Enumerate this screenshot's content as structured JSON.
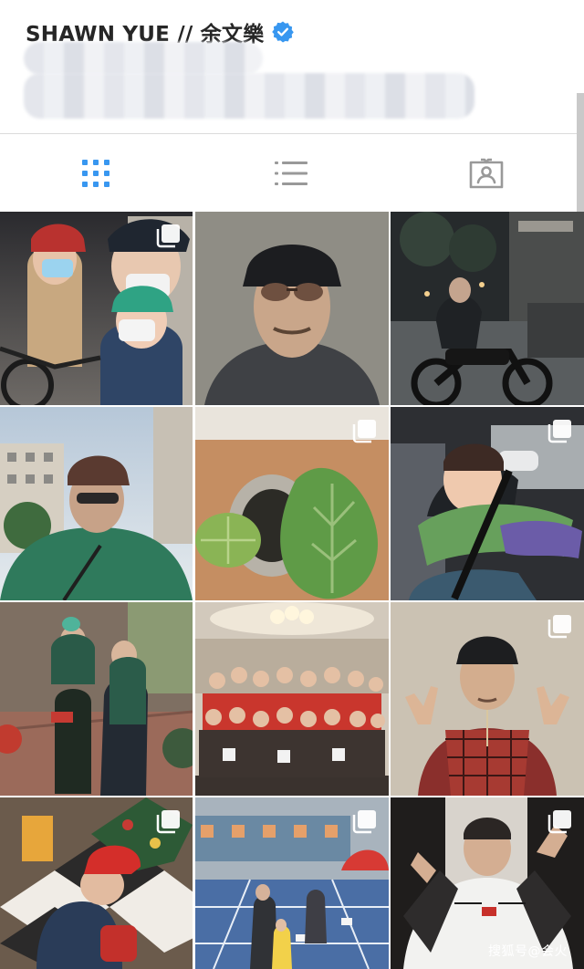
{
  "profile": {
    "username": "SHAWN YUE // 余文樂",
    "verified": true,
    "bio_obscured": true
  },
  "tabs": [
    {
      "name": "tab-grid",
      "icon": "grid-icon",
      "active": true
    },
    {
      "name": "tab-feed",
      "icon": "list-icon",
      "active": false
    },
    {
      "name": "tab-tagged",
      "icon": "tagged-person-icon",
      "active": false
    }
  ],
  "colors": {
    "accent": "#3897f0",
    "icon_inactive": "#999999",
    "verified_badge": "#3897f0"
  },
  "posts": [
    {
      "id": "post-1",
      "description": "family-cycling-selfie",
      "multi": true
    },
    {
      "id": "post-2",
      "description": "selfie-cap-sunglasses",
      "multi": false
    },
    {
      "id": "post-3",
      "description": "motorbike-night-street",
      "multi": false
    },
    {
      "id": "post-4",
      "description": "selfie-building-sky",
      "multi": false
    },
    {
      "id": "post-5",
      "description": "potted-plant",
      "multi": true
    },
    {
      "id": "post-6",
      "description": "child-sleeping-car-seat",
      "multi": true
    },
    {
      "id": "post-7",
      "description": "family-walk",
      "multi": false
    },
    {
      "id": "post-8",
      "description": "christmas-group-photo",
      "multi": false
    },
    {
      "id": "post-9",
      "description": "peace-sign-portrait",
      "multi": true
    },
    {
      "id": "post-10",
      "description": "child-christmas-tree",
      "multi": true
    },
    {
      "id": "post-11",
      "description": "kids-sports-day",
      "multi": true
    },
    {
      "id": "post-12",
      "description": "hoodie-portrait",
      "multi": true
    }
  ],
  "watermark": "搜狐号@会火"
}
